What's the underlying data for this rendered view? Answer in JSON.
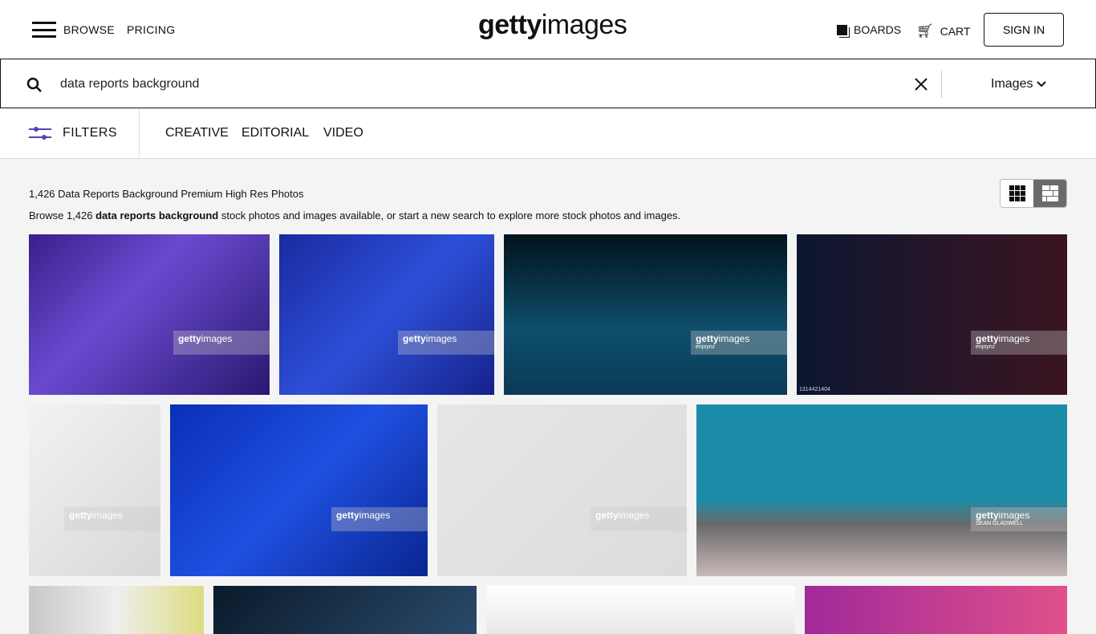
{
  "header": {
    "browse": "BROWSE",
    "pricing": "PRICING",
    "logo_bold": "getty",
    "logo_light": "images",
    "boards": "BOARDS",
    "cart": "CART",
    "signin": "SIGN IN"
  },
  "search": {
    "query": "data reports background",
    "type": "Images"
  },
  "filters": {
    "label": "FILTERS",
    "tabs": [
      "CREATIVE",
      "EDITORIAL",
      "VIDEO"
    ]
  },
  "results": {
    "title": "1,426 Data Reports Background Premium High Res Photos",
    "desc_pre": "Browse 1,426 ",
    "desc_bold": "data reports background",
    "desc_post": " stock photos and images available, or start a new search to explore more stock photos and images."
  },
  "view_toggle": {
    "options": [
      "grid-view",
      "mosaic-view"
    ],
    "selected": "mosaic-view"
  },
  "tiles": [
    {
      "bg": "linear-gradient(135deg,#3a1f8a,#6a4ad0 40%,#2a1870)",
      "contributor": ""
    },
    {
      "bg": "linear-gradient(135deg,#1a2aa0,#2d4fd8 50%,#16228a)",
      "contributor": ""
    },
    {
      "bg": "linear-gradient(180deg,#02121c,#0e4f6c 60%,#0b3a55)",
      "contributor": "enjoynz"
    },
    {
      "bg": "linear-gradient(90deg,#0b1630,#2a1628 60%,#3a1420)",
      "contributor": "enjoynz",
      "id": "1314421404"
    },
    {
      "bg": "linear-gradient(135deg,#f2f2f2,#d8d8d8)",
      "contributor": ""
    },
    {
      "bg": "linear-gradient(135deg,#0a2fb8,#1f50e0 50%,#0a2590)",
      "contributor": ""
    },
    {
      "bg": "linear-gradient(135deg,#e6e6e6,#dcdcdc)",
      "contributor": ""
    },
    {
      "bg": "linear-gradient(180deg,#1a8ca8 55%,#6a6a6a 70%,#c9b9b9)",
      "contributor": "SEAN GLADWELL"
    },
    {
      "bg": "linear-gradient(90deg,#c8c8c8,#eee,#dcdc80)",
      "contributor": ""
    },
    {
      "bg": "linear-gradient(135deg,#0a1a2a,#2a4a6a)",
      "contributor": ""
    },
    {
      "bg": "linear-gradient(180deg,#fff,#e8e8e8)",
      "contributor": ""
    },
    {
      "bg": "linear-gradient(90deg,#a02a9a,#e0508a)",
      "contributor": ""
    }
  ],
  "watermark": {
    "bold": "getty",
    "light": "images"
  }
}
